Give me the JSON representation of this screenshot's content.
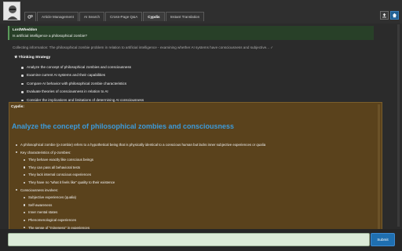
{
  "header": {
    "tabs": [
      {
        "label": "Article Management"
      },
      {
        "label": "AI Search"
      },
      {
        "label": "Cross-Page Q&A"
      },
      {
        "label": "Cypdis",
        "active": true
      },
      {
        "label": "Instant Translation"
      }
    ],
    "icons": [
      "gears-icon",
      "upload-icon",
      "home-icon"
    ]
  },
  "user_message": {
    "name": "LordWheddon",
    "question": "Is artificial intelligence a philosophical zombie?"
  },
  "collecting": "Collecting information: The philosophical zombie problem in relation to artificial intelligence - examining whether AI systems have consciousness and subjective...  ✓",
  "strategy": {
    "title": "Thinking Strategy",
    "items": [
      "Analyze the concept of philosophical zombies and consciousness",
      "Examine current AI systems and their capabilities",
      "Compare AI behavior with philosophical zombie characteristics",
      "Evaluate theories of consciousness in relation to AI",
      "Consider the implications and limitations of determining AI consciousness"
    ]
  },
  "answer": {
    "label": "Cypdis:",
    "heading": "Analyze the concept of philosophical zombies and consciousness",
    "lines": [
      {
        "text": "A philosophical zombie (p-zombie) refers to a hypothetical being that is physically identical to a conscious human but lacks inner subjective experiences or qualia",
        "level": 0
      },
      {
        "text": "Key characteristics of p-zombies:",
        "level": 0
      },
      {
        "text": "They behave exactly like conscious beings",
        "level": 1
      },
      {
        "text": "They can pass all behavioral tests",
        "level": 1
      },
      {
        "text": "They lack internal conscious experiences",
        "level": 1
      },
      {
        "text": "They have no \"what it feels like\" quality to their existence",
        "level": 1
      },
      {
        "text": "Consciousness involves:",
        "level": 0
      },
      {
        "text": "Subjective experiences (qualia)",
        "level": 1
      },
      {
        "text": "Self-awareness",
        "level": 1
      },
      {
        "text": "Inner mental states",
        "level": 1
      },
      {
        "text": "Phenomenological experiences",
        "level": 1
      },
      {
        "text": "The sense of \"mineness\" in experiences",
        "level": 1
      }
    ]
  },
  "input": {
    "value": "",
    "placeholder": ""
  },
  "submit_label": "Submit"
}
